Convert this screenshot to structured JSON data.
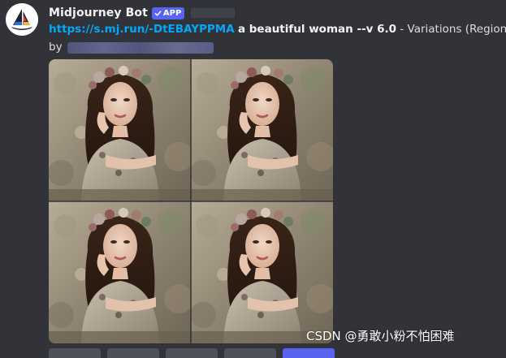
{
  "message": {
    "author": "Midjourney Bot",
    "badge": "APP",
    "link_text": "https://s.mj.run/-DtEBAYPPMA",
    "prompt": "a beautiful woman --v 6.0",
    "suffix": "- Variations (Region)",
    "by_label": "by"
  },
  "image": {
    "description_icon": "image-grid-icon",
    "tile_count": 4
  },
  "watermark": {
    "text": "CSDN @勇敢小粉不怕困难"
  },
  "colors": {
    "background": "#313338",
    "link": "#00a8fc",
    "badge": "#5865f2"
  }
}
